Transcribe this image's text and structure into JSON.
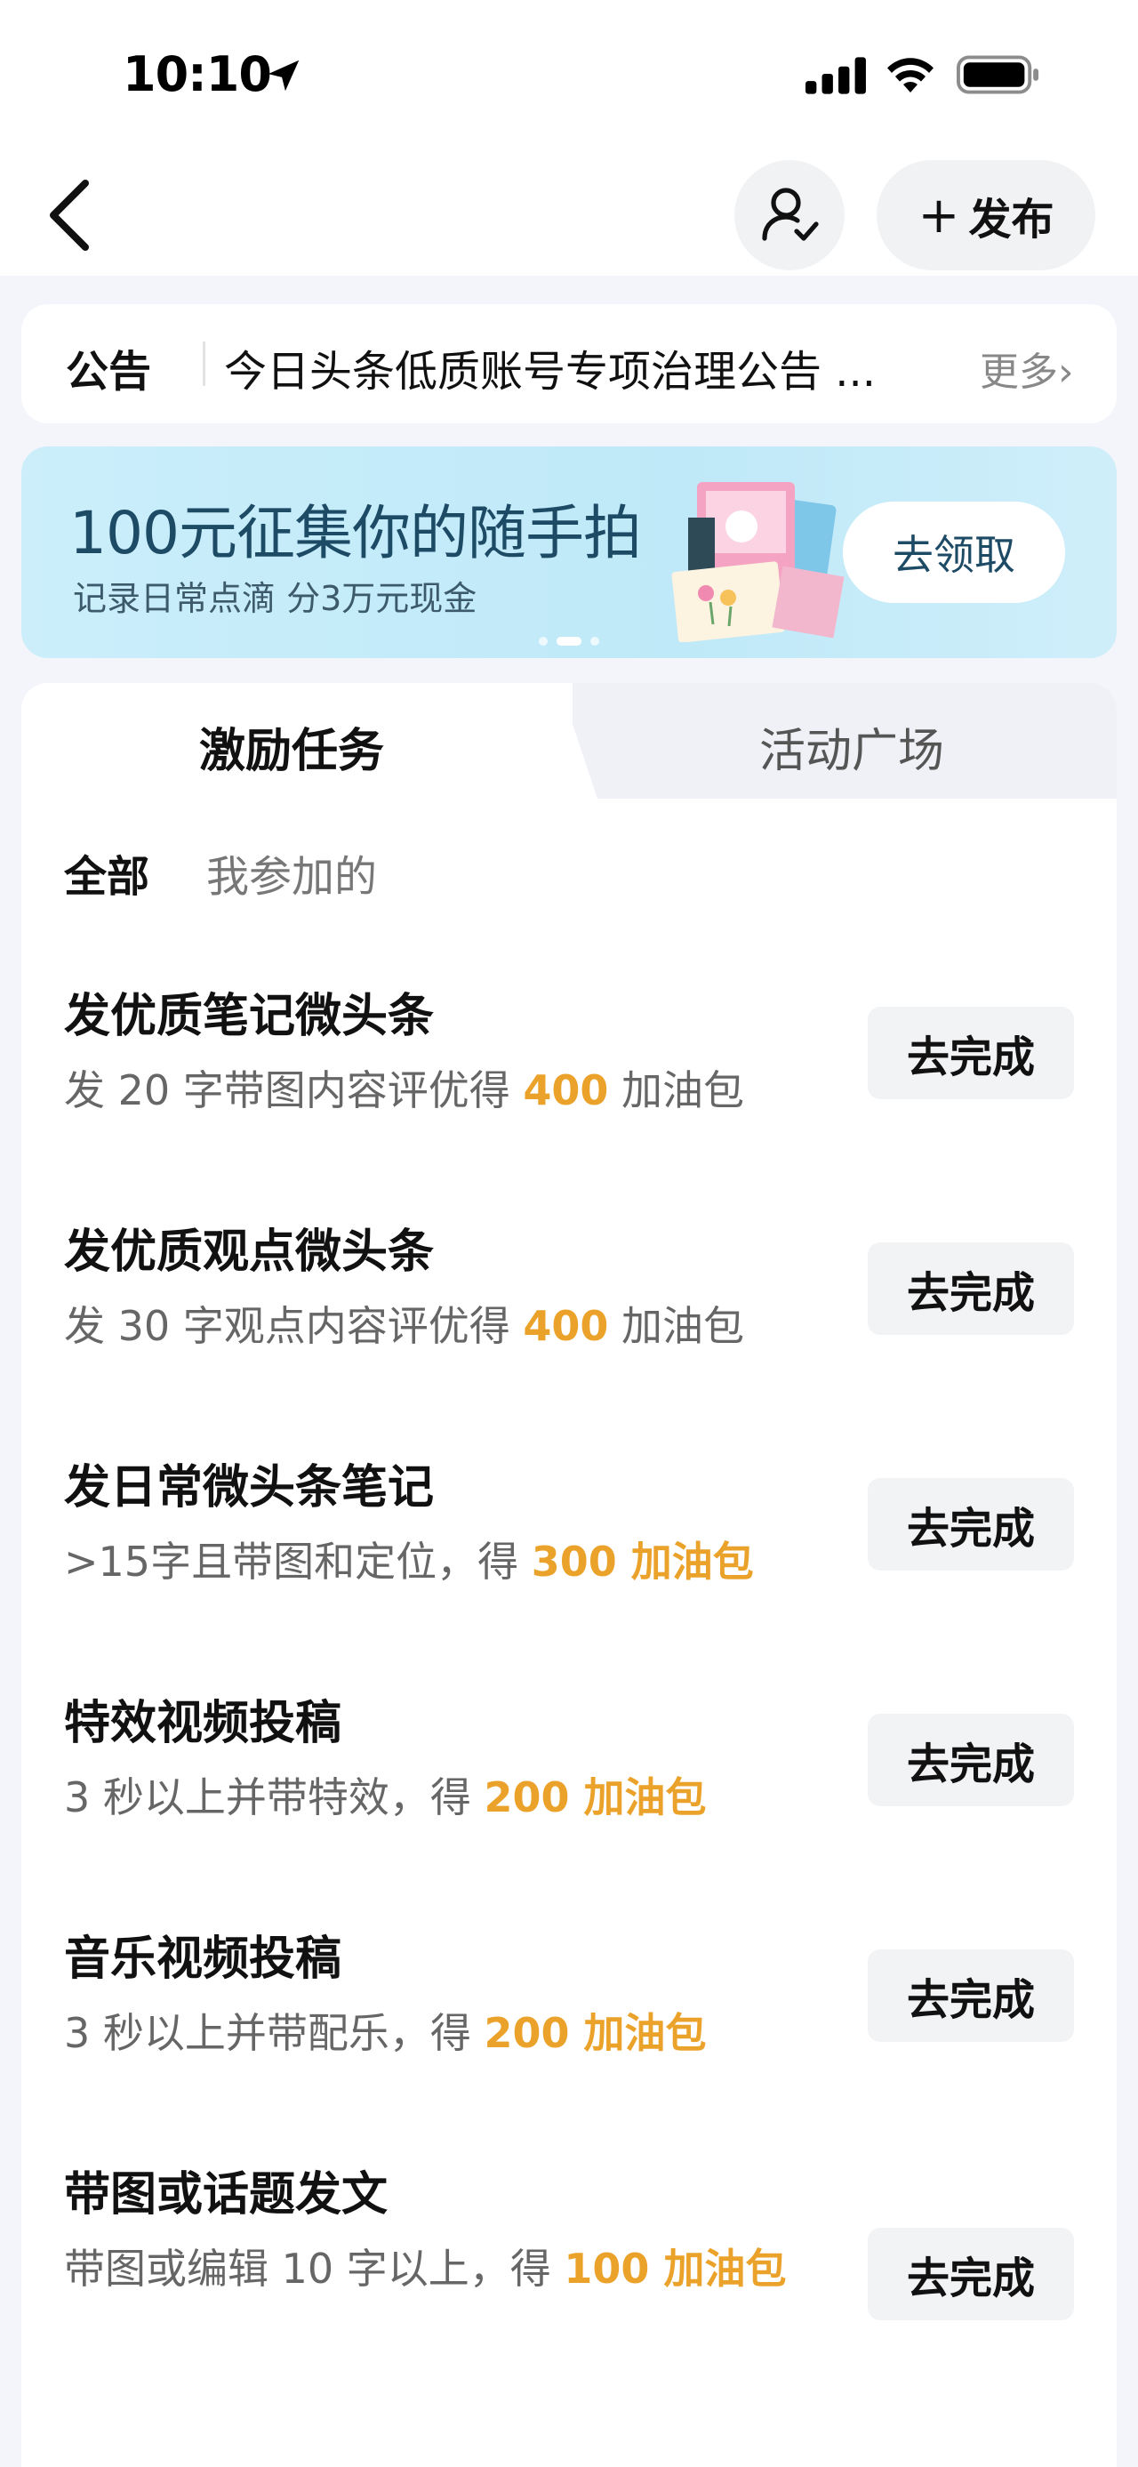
{
  "status_bar": {
    "time": "10:10",
    "icons": [
      "location-arrow-icon",
      "signal-icon",
      "wifi-icon",
      "battery-icon"
    ]
  },
  "nav": {
    "back_icon": "chevron-left-icon",
    "user_icon": "user-check-icon",
    "publish_label": "发布",
    "publish_icon": "plus-icon"
  },
  "notice": {
    "tag": "公告",
    "text": "今日头条低质账号专项治理公告 ...",
    "more": "更多›"
  },
  "banner": {
    "title": "100元征集你的随手拍",
    "subtitle": "记录日常点滴 分3万元现金",
    "cta": "去领取",
    "dots": {
      "count": 3,
      "active_index": 1
    }
  },
  "tabs": [
    {
      "label": "激励任务",
      "active": true
    },
    {
      "label": "活动广场",
      "active": false
    }
  ],
  "filters": [
    {
      "label": "全部",
      "active": true
    },
    {
      "label": "我参加的",
      "active": false
    }
  ],
  "tasks": [
    {
      "title": "发优质笔记微头条",
      "desc_prefix": "发 20 字带图内容评优得 ",
      "reward": "400",
      "desc_suffix": " 加油包",
      "button": "去完成"
    },
    {
      "title": "发优质观点微头条",
      "desc_prefix": "发 30 字观点内容评优得 ",
      "reward": "400",
      "desc_suffix": " 加油包",
      "button": "去完成"
    },
    {
      "title": "发日常微头条笔记",
      "desc_prefix": ">15字且带图和定位，得 ",
      "reward": "300 加油包",
      "desc_suffix": "",
      "button": "去完成"
    },
    {
      "title": "特效视频投稿",
      "desc_prefix": "3 秒以上并带特效，得 ",
      "reward": "200 加油包",
      "desc_suffix": "",
      "button": "去完成"
    },
    {
      "title": "音乐视频投稿",
      "desc_prefix": "3 秒以上并带配乐，得 ",
      "reward": "200 加油包",
      "desc_suffix": "",
      "button": "去完成"
    },
    {
      "title": "带图或话题发文",
      "desc_prefix": "带图或编辑 10 字以上，得 ",
      "reward": "100 加油包",
      "desc_suffix": "",
      "button": "去完成"
    }
  ],
  "colors": {
    "accent_reward": "#eba22a",
    "banner_bg": "#c6ecf9",
    "banner_text": "#1d4b66",
    "page_bg": "#f3f5fb"
  }
}
